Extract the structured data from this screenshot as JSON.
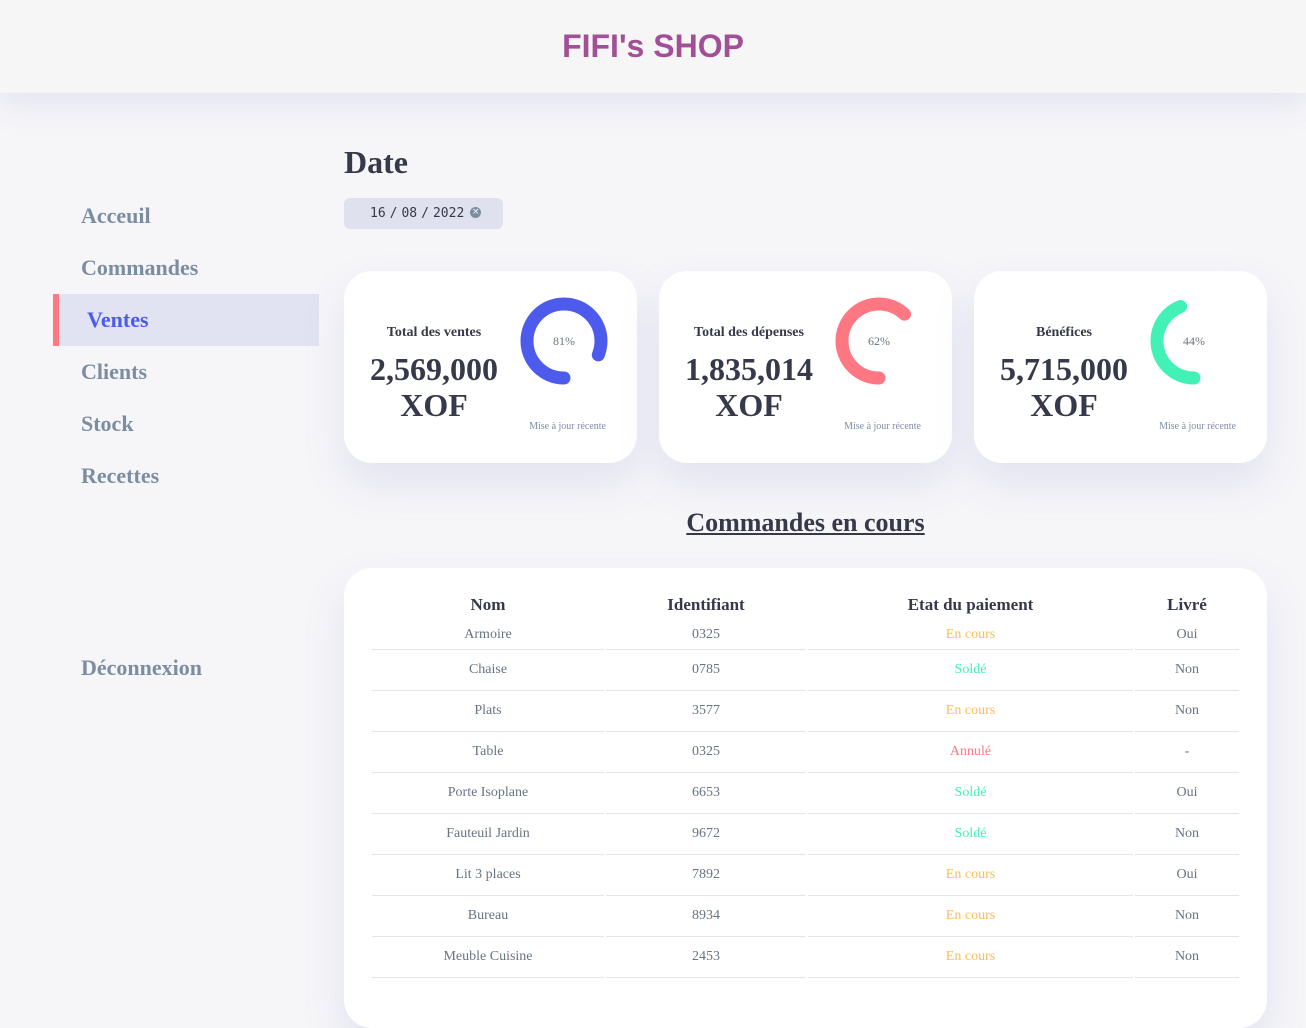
{
  "header": {
    "brand": "FIFI's SHOP"
  },
  "sidebar": {
    "items": [
      {
        "label": "Acceuil",
        "active": false
      },
      {
        "label": "Commandes",
        "active": false
      },
      {
        "label": "Ventes",
        "active": true
      },
      {
        "label": "Clients",
        "active": false
      },
      {
        "label": "Stock",
        "active": false
      },
      {
        "label": "Recettes",
        "active": false
      }
    ],
    "logout": "Déconnexion"
  },
  "date": {
    "title": "Date",
    "day": "16",
    "month": "08",
    "year": "2022",
    "sep": "/"
  },
  "cards": [
    {
      "label": "Total des ventes",
      "value_line1": "2,569,000",
      "value_line2": "XOF",
      "percent": "81%",
      "percent_value": 81,
      "color": "#4c5bec",
      "footer": "Mise à jour récente"
    },
    {
      "label": "Total des dépenses",
      "value_line1": "1,835,014",
      "value_line2": "XOF",
      "percent": "62%",
      "percent_value": 62,
      "color": "#ff7782",
      "footer": "Mise à jour récente"
    },
    {
      "label": "Bénéfices",
      "value_line1": "5,715,000",
      "value_line2": "XOF",
      "percent": "44%",
      "percent_value": 44,
      "color": "#41f1b6",
      "footer": "Mise à jour récente"
    }
  ],
  "orders": {
    "title": "Commandes en cours",
    "columns": [
      "Nom",
      "Identifiant",
      "Etat du paiement",
      "Livré"
    ],
    "rows": [
      {
        "name": "Armoire",
        "id": "0325",
        "status": "En cours",
        "status_type": "pending",
        "delivered": "Oui"
      },
      {
        "name": "Chaise",
        "id": "0785",
        "status": "Soldé",
        "status_type": "paid",
        "delivered": "Non"
      },
      {
        "name": "Plats",
        "id": "3577",
        "status": "En cours",
        "status_type": "pending",
        "delivered": "Non"
      },
      {
        "name": "Table",
        "id": "0325",
        "status": "Annulé",
        "status_type": "cancel",
        "delivered": "-"
      },
      {
        "name": "Porte Isoplane",
        "id": "6653",
        "status": "Soldé",
        "status_type": "paid",
        "delivered": "Oui"
      },
      {
        "name": "Fauteuil Jardin",
        "id": "9672",
        "status": "Soldé",
        "status_type": "paid",
        "delivered": "Non"
      },
      {
        "name": "Lit 3 places",
        "id": "7892",
        "status": "En cours",
        "status_type": "pending",
        "delivered": "Oui"
      },
      {
        "name": "Bureau",
        "id": "8934",
        "status": "En cours",
        "status_type": "pending",
        "delivered": "Non"
      },
      {
        "name": "Meuble Cuisine",
        "id": "2453",
        "status": "En cours",
        "status_type": "pending",
        "delivered": "Non"
      }
    ]
  },
  "colors": {
    "pending": "#ffbb55",
    "paid": "#41f1b6",
    "cancel": "#ff7782",
    "primary": "#4c5bec",
    "brand": "#a24f97"
  }
}
